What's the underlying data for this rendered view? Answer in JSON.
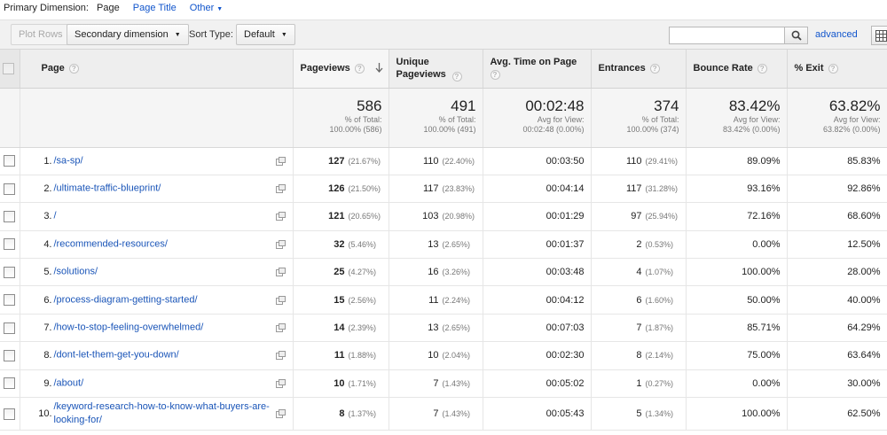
{
  "primary_dimension": {
    "label": "Primary Dimension:",
    "current": "Page",
    "options": [
      "Page Title"
    ],
    "other": "Other"
  },
  "toolbar": {
    "plot_rows": "Plot Rows",
    "secondary_dimension": "Secondary dimension",
    "sort_type_label": "Sort Type:",
    "sort_type_value": "Default",
    "search_value": "",
    "advanced": "advanced"
  },
  "columns": {
    "page": "Page",
    "pageviews": "Pageviews",
    "unique_pageviews": "Unique Pageviews",
    "avg_time": "Avg. Time on Page",
    "entrances": "Entrances",
    "bounce_rate": "Bounce Rate",
    "exit": "% Exit"
  },
  "totals": {
    "pageviews": {
      "value": "586",
      "l1": "% of Total:",
      "l2": "100.00% (586)"
    },
    "unique_pageviews": {
      "value": "491",
      "l1": "% of Total:",
      "l2": "100.00% (491)"
    },
    "avg_time": {
      "value": "00:02:48",
      "l1": "Avg for View:",
      "l2": "00:02:48 (0.00%)"
    },
    "entrances": {
      "value": "374",
      "l1": "% of Total:",
      "l2": "100.00% (374)"
    },
    "bounce_rate": {
      "value": "83.42%",
      "l1": "Avg for View:",
      "l2": "83.42% (0.00%)"
    },
    "exit": {
      "value": "63.82%",
      "l1": "Avg for View:",
      "l2": "63.82% (0.00%)"
    }
  },
  "rows": [
    {
      "num": "1.",
      "page": "/sa-sp/",
      "pv": "127",
      "pv_pct": "(21.67%)",
      "upv": "110",
      "upv_pct": "(22.40%)",
      "time": "00:03:50",
      "ent": "110",
      "ent_pct": "(29.41%)",
      "bounce": "89.09%",
      "exit": "85.83%"
    },
    {
      "num": "2.",
      "page": "/ultimate-traffic-blueprint/",
      "pv": "126",
      "pv_pct": "(21.50%)",
      "upv": "117",
      "upv_pct": "(23.83%)",
      "time": "00:04:14",
      "ent": "117",
      "ent_pct": "(31.28%)",
      "bounce": "93.16%",
      "exit": "92.86%"
    },
    {
      "num": "3.",
      "page": "/",
      "pv": "121",
      "pv_pct": "(20.65%)",
      "upv": "103",
      "upv_pct": "(20.98%)",
      "time": "00:01:29",
      "ent": "97",
      "ent_pct": "(25.94%)",
      "bounce": "72.16%",
      "exit": "68.60%"
    },
    {
      "num": "4.",
      "page": "/recommended-resources/",
      "pv": "32",
      "pv_pct": "(5.46%)",
      "upv": "13",
      "upv_pct": "(2.65%)",
      "time": "00:01:37",
      "ent": "2",
      "ent_pct": "(0.53%)",
      "bounce": "0.00%",
      "exit": "12.50%"
    },
    {
      "num": "5.",
      "page": "/solutions/",
      "pv": "25",
      "pv_pct": "(4.27%)",
      "upv": "16",
      "upv_pct": "(3.26%)",
      "time": "00:03:48",
      "ent": "4",
      "ent_pct": "(1.07%)",
      "bounce": "100.00%",
      "exit": "28.00%"
    },
    {
      "num": "6.",
      "page": "/process-diagram-getting-started/",
      "pv": "15",
      "pv_pct": "(2.56%)",
      "upv": "11",
      "upv_pct": "(2.24%)",
      "time": "00:04:12",
      "ent": "6",
      "ent_pct": "(1.60%)",
      "bounce": "50.00%",
      "exit": "40.00%"
    },
    {
      "num": "7.",
      "page": "/how-to-stop-feeling-overwhelmed/",
      "pv": "14",
      "pv_pct": "(2.39%)",
      "upv": "13",
      "upv_pct": "(2.65%)",
      "time": "00:07:03",
      "ent": "7",
      "ent_pct": "(1.87%)",
      "bounce": "85.71%",
      "exit": "64.29%"
    },
    {
      "num": "8.",
      "page": "/dont-let-them-get-you-down/",
      "pv": "11",
      "pv_pct": "(1.88%)",
      "upv": "10",
      "upv_pct": "(2.04%)",
      "time": "00:02:30",
      "ent": "8",
      "ent_pct": "(2.14%)",
      "bounce": "75.00%",
      "exit": "63.64%"
    },
    {
      "num": "9.",
      "page": "/about/",
      "pv": "10",
      "pv_pct": "(1.71%)",
      "upv": "7",
      "upv_pct": "(1.43%)",
      "time": "00:05:02",
      "ent": "1",
      "ent_pct": "(0.27%)",
      "bounce": "0.00%",
      "exit": "30.00%"
    },
    {
      "num": "10.",
      "page": "/keyword-research-how-to-know-what-buyers-are-looking-for/",
      "pv": "8",
      "pv_pct": "(1.37%)",
      "upv": "7",
      "upv_pct": "(1.43%)",
      "time": "00:05:43",
      "ent": "5",
      "ent_pct": "(1.34%)",
      "bounce": "100.00%",
      "exit": "62.50%"
    }
  ],
  "colors": {
    "link": "#1a55b8",
    "header_bg": "#eeeeee",
    "totals_bg": "#f5f5f5"
  },
  "icons": {
    "search": "magnifier-icon",
    "grid": "table-grid-icon",
    "external": "open-external-icon",
    "help": "question-icon",
    "sort": "sort-down-arrow-icon"
  }
}
